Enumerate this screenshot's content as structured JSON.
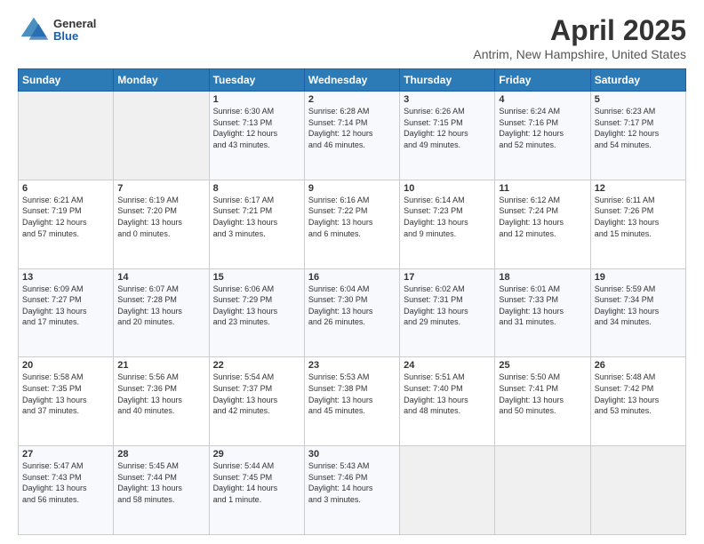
{
  "header": {
    "logo_general": "General",
    "logo_blue": "Blue",
    "main_title": "April 2025",
    "subtitle": "Antrim, New Hampshire, United States"
  },
  "days_of_week": [
    "Sunday",
    "Monday",
    "Tuesday",
    "Wednesday",
    "Thursday",
    "Friday",
    "Saturday"
  ],
  "weeks": [
    [
      {
        "day": "",
        "info": ""
      },
      {
        "day": "",
        "info": ""
      },
      {
        "day": "1",
        "info": "Sunrise: 6:30 AM\nSunset: 7:13 PM\nDaylight: 12 hours\nand 43 minutes."
      },
      {
        "day": "2",
        "info": "Sunrise: 6:28 AM\nSunset: 7:14 PM\nDaylight: 12 hours\nand 46 minutes."
      },
      {
        "day": "3",
        "info": "Sunrise: 6:26 AM\nSunset: 7:15 PM\nDaylight: 12 hours\nand 49 minutes."
      },
      {
        "day": "4",
        "info": "Sunrise: 6:24 AM\nSunset: 7:16 PM\nDaylight: 12 hours\nand 52 minutes."
      },
      {
        "day": "5",
        "info": "Sunrise: 6:23 AM\nSunset: 7:17 PM\nDaylight: 12 hours\nand 54 minutes."
      }
    ],
    [
      {
        "day": "6",
        "info": "Sunrise: 6:21 AM\nSunset: 7:19 PM\nDaylight: 12 hours\nand 57 minutes."
      },
      {
        "day": "7",
        "info": "Sunrise: 6:19 AM\nSunset: 7:20 PM\nDaylight: 13 hours\nand 0 minutes."
      },
      {
        "day": "8",
        "info": "Sunrise: 6:17 AM\nSunset: 7:21 PM\nDaylight: 13 hours\nand 3 minutes."
      },
      {
        "day": "9",
        "info": "Sunrise: 6:16 AM\nSunset: 7:22 PM\nDaylight: 13 hours\nand 6 minutes."
      },
      {
        "day": "10",
        "info": "Sunrise: 6:14 AM\nSunset: 7:23 PM\nDaylight: 13 hours\nand 9 minutes."
      },
      {
        "day": "11",
        "info": "Sunrise: 6:12 AM\nSunset: 7:24 PM\nDaylight: 13 hours\nand 12 minutes."
      },
      {
        "day": "12",
        "info": "Sunrise: 6:11 AM\nSunset: 7:26 PM\nDaylight: 13 hours\nand 15 minutes."
      }
    ],
    [
      {
        "day": "13",
        "info": "Sunrise: 6:09 AM\nSunset: 7:27 PM\nDaylight: 13 hours\nand 17 minutes."
      },
      {
        "day": "14",
        "info": "Sunrise: 6:07 AM\nSunset: 7:28 PM\nDaylight: 13 hours\nand 20 minutes."
      },
      {
        "day": "15",
        "info": "Sunrise: 6:06 AM\nSunset: 7:29 PM\nDaylight: 13 hours\nand 23 minutes."
      },
      {
        "day": "16",
        "info": "Sunrise: 6:04 AM\nSunset: 7:30 PM\nDaylight: 13 hours\nand 26 minutes."
      },
      {
        "day": "17",
        "info": "Sunrise: 6:02 AM\nSunset: 7:31 PM\nDaylight: 13 hours\nand 29 minutes."
      },
      {
        "day": "18",
        "info": "Sunrise: 6:01 AM\nSunset: 7:33 PM\nDaylight: 13 hours\nand 31 minutes."
      },
      {
        "day": "19",
        "info": "Sunrise: 5:59 AM\nSunset: 7:34 PM\nDaylight: 13 hours\nand 34 minutes."
      }
    ],
    [
      {
        "day": "20",
        "info": "Sunrise: 5:58 AM\nSunset: 7:35 PM\nDaylight: 13 hours\nand 37 minutes."
      },
      {
        "day": "21",
        "info": "Sunrise: 5:56 AM\nSunset: 7:36 PM\nDaylight: 13 hours\nand 40 minutes."
      },
      {
        "day": "22",
        "info": "Sunrise: 5:54 AM\nSunset: 7:37 PM\nDaylight: 13 hours\nand 42 minutes."
      },
      {
        "day": "23",
        "info": "Sunrise: 5:53 AM\nSunset: 7:38 PM\nDaylight: 13 hours\nand 45 minutes."
      },
      {
        "day": "24",
        "info": "Sunrise: 5:51 AM\nSunset: 7:40 PM\nDaylight: 13 hours\nand 48 minutes."
      },
      {
        "day": "25",
        "info": "Sunrise: 5:50 AM\nSunset: 7:41 PM\nDaylight: 13 hours\nand 50 minutes."
      },
      {
        "day": "26",
        "info": "Sunrise: 5:48 AM\nSunset: 7:42 PM\nDaylight: 13 hours\nand 53 minutes."
      }
    ],
    [
      {
        "day": "27",
        "info": "Sunrise: 5:47 AM\nSunset: 7:43 PM\nDaylight: 13 hours\nand 56 minutes."
      },
      {
        "day": "28",
        "info": "Sunrise: 5:45 AM\nSunset: 7:44 PM\nDaylight: 13 hours\nand 58 minutes."
      },
      {
        "day": "29",
        "info": "Sunrise: 5:44 AM\nSunset: 7:45 PM\nDaylight: 14 hours\nand 1 minute."
      },
      {
        "day": "30",
        "info": "Sunrise: 5:43 AM\nSunset: 7:46 PM\nDaylight: 14 hours\nand 3 minutes."
      },
      {
        "day": "",
        "info": ""
      },
      {
        "day": "",
        "info": ""
      },
      {
        "day": "",
        "info": ""
      }
    ]
  ]
}
